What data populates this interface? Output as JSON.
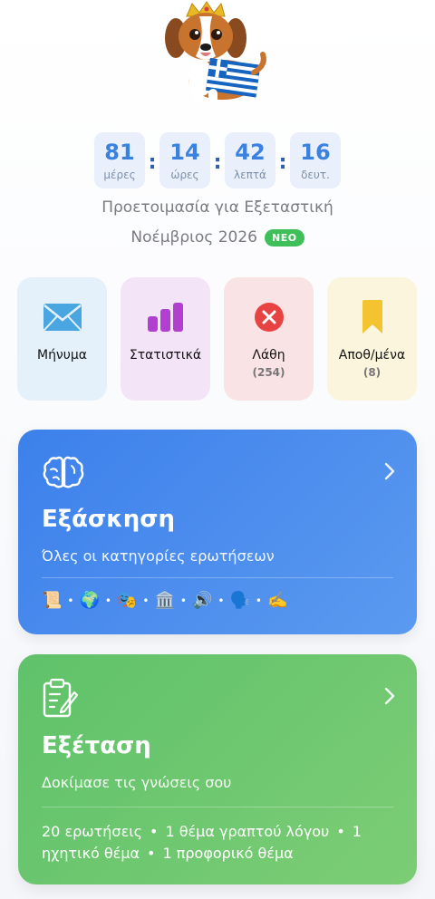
{
  "mascot": {
    "icon": "puppy-mascot-with-greek-flag-and-crown"
  },
  "countdown": [
    {
      "value": "81",
      "unit": "μέρες"
    },
    {
      "value": "14",
      "unit": "ώρες"
    },
    {
      "value": "42",
      "unit": "λεπτά"
    },
    {
      "value": "16",
      "unit": "δευτ."
    }
  ],
  "separator": ":",
  "header": {
    "subtitle": "Προετοιμασία για Εξεταστική",
    "session": "Νοέμβριος 2026",
    "badge": "ΝΕΟ"
  },
  "tiles": {
    "message": {
      "label": "Μήνυμα",
      "icon": "envelope-icon",
      "color": "#4aa6e0"
    },
    "stats": {
      "label": "Στατιστικά",
      "icon": "bar-chart-icon",
      "color": "#b13fcf"
    },
    "mistakes": {
      "label": "Λάθη",
      "count": "(254)",
      "icon": "error-x-icon",
      "color": "#e84343"
    },
    "saved": {
      "label": "Αποθ/μένα",
      "count": "(8)",
      "icon": "bookmark-icon",
      "color": "#f4c430"
    }
  },
  "practice": {
    "title": "Εξάσκηση",
    "subtitle": "Όλες οι κατηγορίες ερωτήσεων",
    "emojis": [
      "📜",
      "🌍",
      "🎭",
      "🏛️",
      "🔊",
      "🗣️",
      "✍️"
    ],
    "color": "#3c80eb"
  },
  "exam": {
    "title": "Εξέταση",
    "subtitle": "Δοκίμασε τις γνώσεις σου",
    "details": [
      "20 ερωτήσεις",
      "1 θέμα γραπτού λόγου",
      "1 ηχητικό θέμα",
      "1 προφορικό θέμα"
    ],
    "color": "#5fc26a"
  }
}
